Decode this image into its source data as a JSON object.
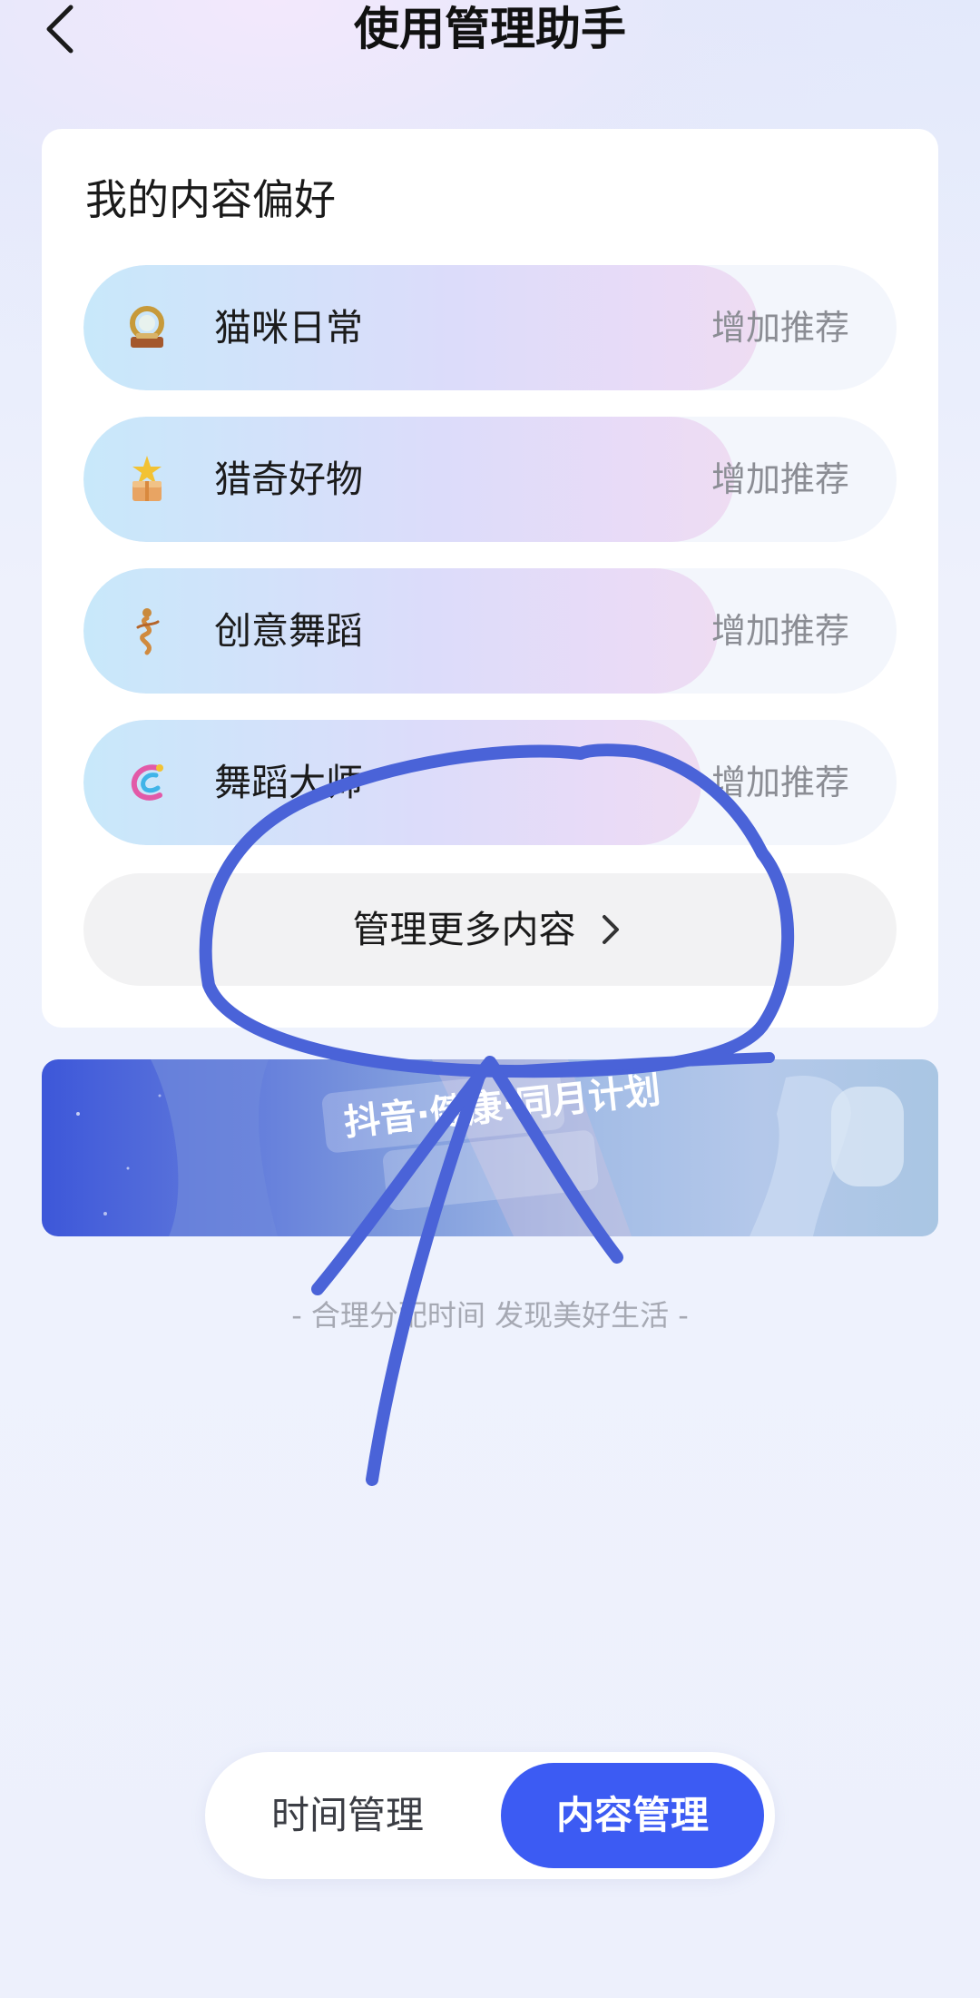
{
  "header": {
    "title": "使用管理助手",
    "back_icon": "chevron-left-icon"
  },
  "preferences": {
    "title": "我的内容偏好",
    "items": [
      {
        "label": "猫咪日常",
        "action": "增加推荐",
        "icon": "cat-badge-icon",
        "level": 0.83
      },
      {
        "label": "猎奇好物",
        "action": "增加推荐",
        "icon": "gift-box-icon",
        "level": 0.8
      },
      {
        "label": "创意舞蹈",
        "action": "增加推荐",
        "icon": "dancer-icon",
        "level": 0.78
      },
      {
        "label": "舞蹈大师",
        "action": "增加推荐",
        "icon": "dance-master-icon",
        "level": 0.76
      }
    ],
    "more_label": "管理更多内容",
    "more_icon": "chevron-right-icon"
  },
  "banner": {
    "text": "抖音·健康·同月计划"
  },
  "slogan": "- 合理分配时间 发现美好生活 -",
  "tabs": {
    "time_label": "时间管理",
    "content_label": "内容管理",
    "active": "内容管理",
    "accent": "#3c5bf3"
  },
  "annotation_color": "#4a63d8"
}
